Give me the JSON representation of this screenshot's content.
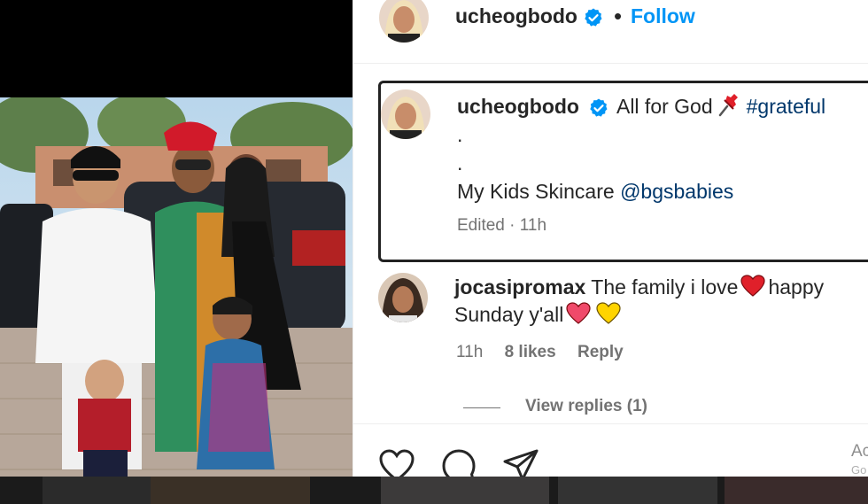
{
  "header": {
    "username": "ucheogbodo",
    "separator": "•",
    "follow_label": "Follow"
  },
  "caption": {
    "username": "ucheogbodo",
    "text_part1": "All for God",
    "hashtag": "#grateful",
    "dot1": ".",
    "dot2": ".",
    "line3_text": "My Kids Skincare",
    "mention": "@bgsbabies",
    "edited": "Edited",
    "meta_sep": "·",
    "time": "11h"
  },
  "comment": {
    "username": "jocasipromax",
    "text_part1": "The family i love",
    "text_part2": "happy Sunday y'all",
    "time": "11h",
    "likes": "8 likes",
    "reply_label": "Reply"
  },
  "view_replies": "View replies (1)",
  "actions": {
    "icons": [
      "heart-icon",
      "comment-icon",
      "share-icon"
    ],
    "ad_text": "Ac",
    "ad_sub": "Go"
  },
  "colors": {
    "link_blue": "#0095f6",
    "verified_blue": "#0095f6",
    "hashtag": "#00376b",
    "meta_gray": "#737373",
    "heart_red": "#e0245e",
    "heart_yellow": "#ffd400"
  }
}
